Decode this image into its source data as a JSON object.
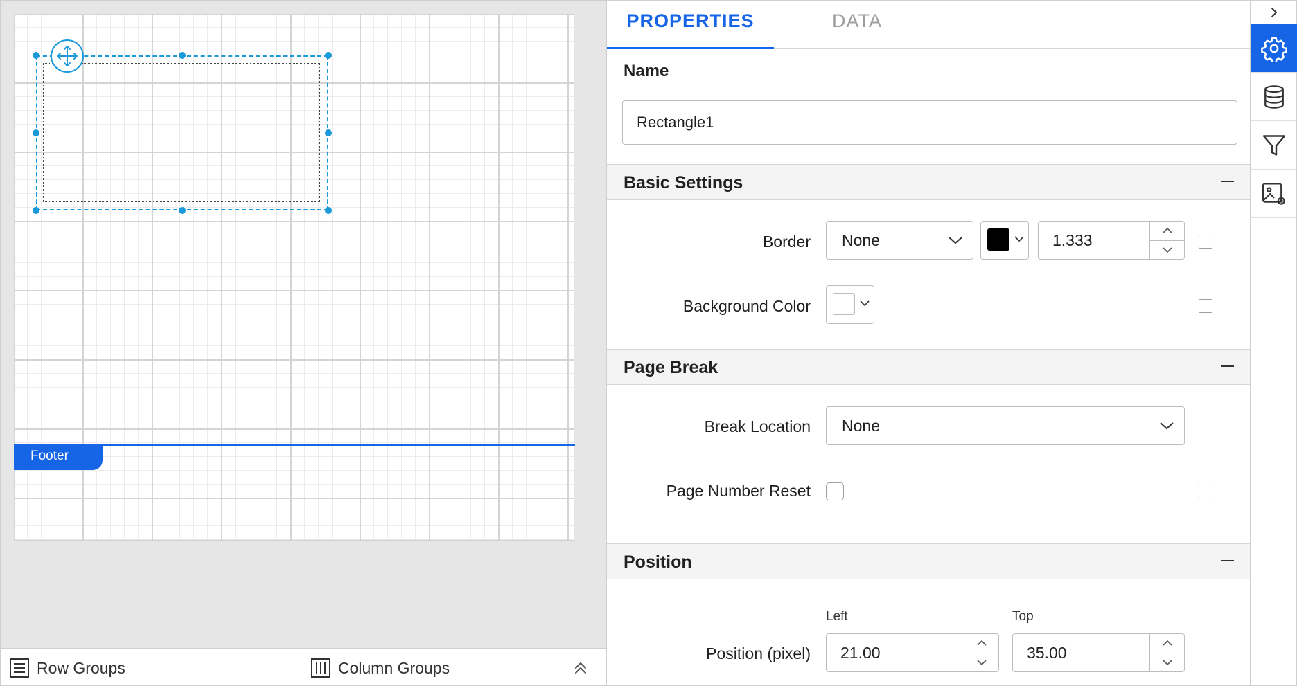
{
  "canvas": {
    "footer_label": "Footer"
  },
  "bottom_bar": {
    "row_groups_label": "Row Groups",
    "column_groups_label": "Column Groups"
  },
  "tabs": {
    "properties": "PROPERTIES",
    "data": "DATA"
  },
  "name_section": {
    "label": "Name",
    "value": "Rectangle1"
  },
  "basic_settings": {
    "title": "Basic Settings",
    "border_label": "Border",
    "border_style": "None",
    "border_color": "#000000",
    "border_width": "1.333",
    "background_label": "Background Color",
    "background_color": "#ffffff"
  },
  "page_break": {
    "title": "Page Break",
    "break_location_label": "Break Location",
    "break_location_value": "None",
    "page_number_reset_label": "Page Number Reset"
  },
  "position": {
    "title": "Position",
    "left_label": "Left",
    "top_label": "Top",
    "position_label": "Position (pixel)",
    "left_value": "21.00",
    "top_value": "35.00"
  },
  "colors": {
    "accent": "#1565e6",
    "selection": "#1b9ad9"
  },
  "icons": {
    "rail": [
      "chevron-right-icon",
      "gear-icon",
      "database-icon",
      "filter-icon",
      "image-settings-icon"
    ]
  }
}
